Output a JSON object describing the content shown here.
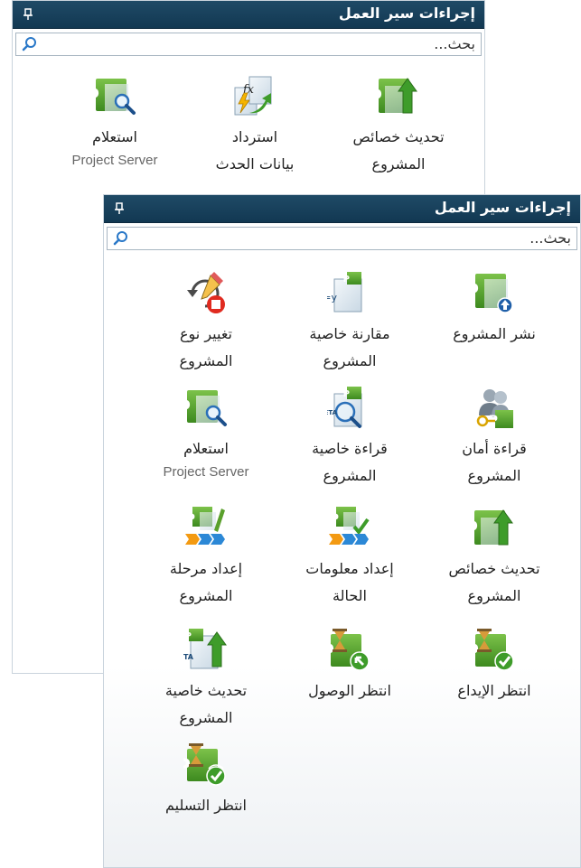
{
  "colors": {
    "titlebar": "#1a4360",
    "project_green": "#5aa02c",
    "arrow_green": "#3e9c2a",
    "stop_red": "#e02b20",
    "hourglass": "#d79b3a"
  },
  "back_panel": {
    "title": "إجراءات سير العمل",
    "pin_icon": "pin-icon",
    "search": {
      "placeholder": "بحث...",
      "icon": "search-icon"
    },
    "tiles": [
      {
        "label": "تحديث خصائص\nالمشروع",
        "icon": "project-update-properties-icon"
      },
      {
        "label": "استرداد\nبيانات الحدث",
        "icon": "restore-event-data-icon"
      },
      {
        "label": "استعلام",
        "sublabel": "Project Server",
        "icon": "project-server-query-icon"
      }
    ]
  },
  "front_panel": {
    "title": "إجراءات سير العمل",
    "pin_icon": "pin-icon",
    "search": {
      "placeholder": "بحث...",
      "icon": "search-icon"
    },
    "tiles": [
      {
        "label": "نشر المشروع",
        "icon": "publish-project-icon"
      },
      {
        "label": "مقارنة خاصية\nالمشروع",
        "icon": "compare-property-icon"
      },
      {
        "label": "تغيير نوع\nالمشروع",
        "icon": "change-project-type-icon"
      },
      {
        "label": "قراءة أمان\nالمشروع",
        "icon": "read-security-icon"
      },
      {
        "label": "قراءة خاصية\nالمشروع",
        "icon": "read-property-icon"
      },
      {
        "label": "استعلام",
        "sublabel": "Project Server",
        "icon": "project-server-query-icon"
      },
      {
        "label": "تحديث خصائص\nالمشروع",
        "icon": "update-properties-icon"
      },
      {
        "label": "إعداد معلومات\nالحالة",
        "icon": "set-status-info-icon"
      },
      {
        "label": "إعداد مرحلة\nالمشروع",
        "icon": "set-project-stage-icon"
      },
      {
        "label": "انتظر الإيداع",
        "icon": "wait-checkin-icon"
      },
      {
        "label": "انتظر الوصول",
        "icon": "wait-arrival-icon"
      },
      {
        "label": "تحديث خاصية\nالمشروع",
        "icon": "update-property-icon"
      },
      {
        "label": "انتظر التسليم",
        "icon": "wait-commit-icon"
      }
    ]
  }
}
